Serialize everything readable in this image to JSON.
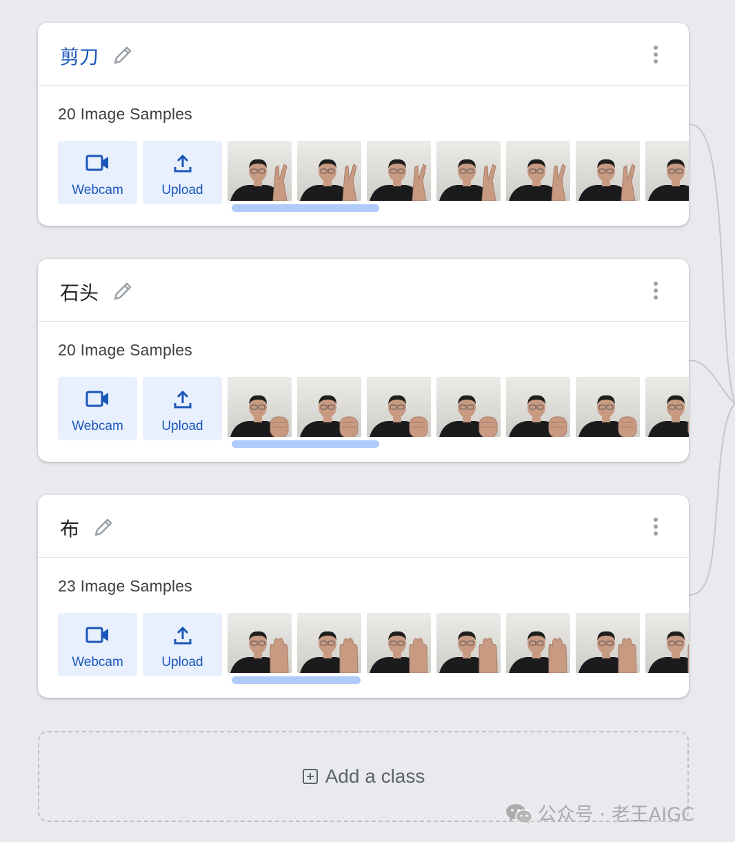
{
  "classes": [
    {
      "name": "剪刀",
      "name_active": true,
      "samples_label": "20 Image Samples",
      "webcam_label": "Webcam",
      "upload_label": "Upload",
      "gesture": "scissors",
      "thumbnail_count_visible": 7,
      "scroll_fraction": 0.32
    },
    {
      "name": "石头",
      "name_active": false,
      "samples_label": "20 Image Samples",
      "webcam_label": "Webcam",
      "upload_label": "Upload",
      "gesture": "rock",
      "thumbnail_count_visible": 7,
      "scroll_fraction": 0.32
    },
    {
      "name": "布",
      "name_active": false,
      "samples_label": "23 Image Samples",
      "webcam_label": "Webcam",
      "upload_label": "Upload",
      "gesture": "paper",
      "thumbnail_count_visible": 7,
      "scroll_fraction": 0.28
    }
  ],
  "add_class": {
    "label": "Add a class",
    "icon": "add-box-icon"
  },
  "watermark": {
    "text": "公众号 · 老王AIGC",
    "icon": "wechat-icon"
  },
  "icons": {
    "edit": "pencil-icon",
    "menu": "more-vert-icon",
    "webcam": "videocam-icon",
    "upload": "upload-icon"
  },
  "colors": {
    "background": "#e8eaed",
    "accent": "#1a56b8",
    "button_bg": "#e8f0fe",
    "scrollbar": "#aecbfa"
  }
}
